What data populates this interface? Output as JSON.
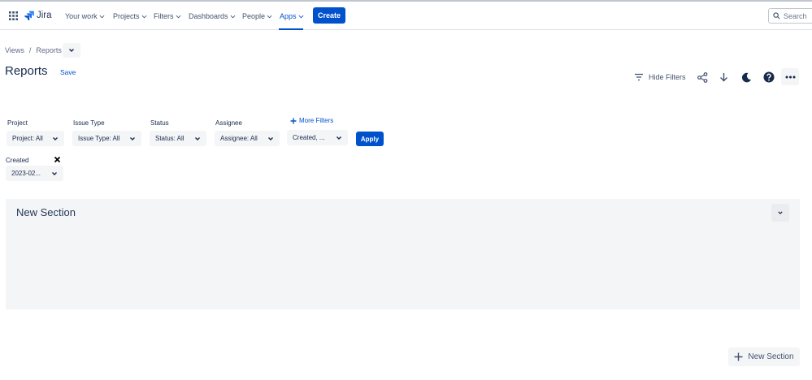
{
  "nav": {
    "brand": "Jira",
    "items": [
      {
        "label": "Your work"
      },
      {
        "label": "Projects"
      },
      {
        "label": "Filters"
      },
      {
        "label": "Dashboards"
      },
      {
        "label": "People"
      },
      {
        "label": "Apps",
        "active": true
      }
    ],
    "create_label": "Create",
    "search_placeholder": "Search"
  },
  "breadcrumb": [
    "Views",
    "Reports"
  ],
  "page": {
    "title": "Reports",
    "save_label": "Save"
  },
  "toolbar": {
    "hide_filters_label": "Hide Filters",
    "icons": [
      "share-icon",
      "download-icon",
      "moon-icon",
      "help-icon",
      "more-icon"
    ]
  },
  "filters": [
    {
      "label": "Project",
      "value": "Project: All"
    },
    {
      "label": "Issue Type",
      "value": "Issue Type: All"
    },
    {
      "label": "Status",
      "value": "Status: All"
    },
    {
      "label": "Assignee",
      "value": "Assignee: All"
    }
  ],
  "more_filters": {
    "label": "More Filters",
    "value": "Created, ..."
  },
  "apply_label": "Apply",
  "created_filter": {
    "label": "Created",
    "value": "2023-02..."
  },
  "section": {
    "title": "New Section"
  },
  "new_section_label": "New Section",
  "colors": {
    "accent": "#0052cc",
    "text": "#172b4d",
    "subtle": "#42526e",
    "surface": "#f4f5f7"
  }
}
